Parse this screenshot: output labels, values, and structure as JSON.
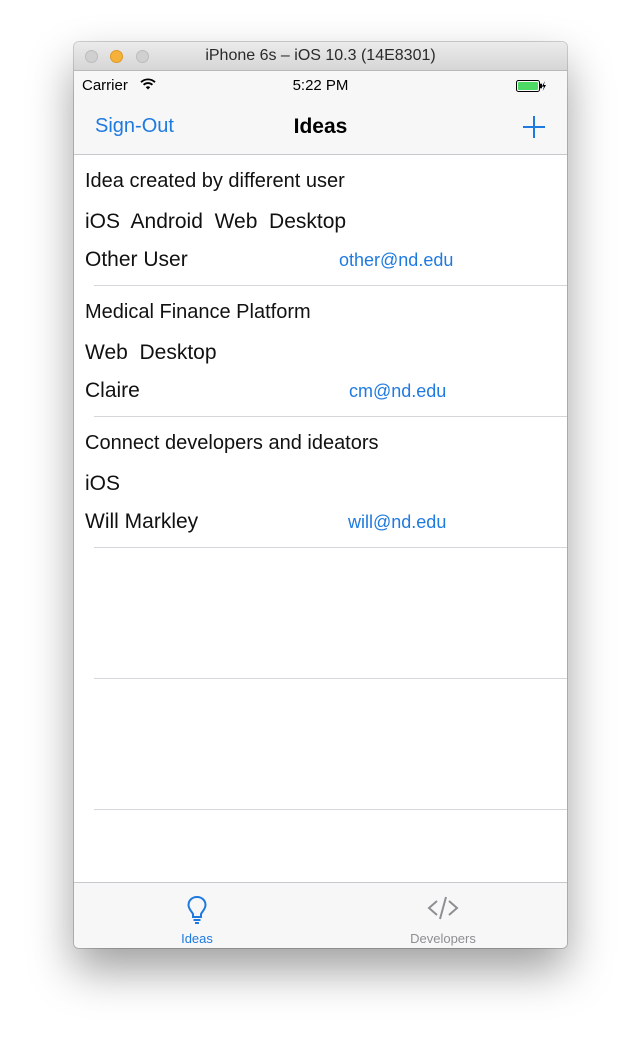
{
  "window": {
    "title": "iPhone 6s – iOS 10.3 (14E8301)"
  },
  "status": {
    "carrier": "Carrier",
    "time": "5:22 PM",
    "wifi_icon": "wifi-icon",
    "battery_icon": "battery-charging-icon",
    "battery_level": 1.0,
    "battery_color": "#4cd964"
  },
  "nav": {
    "left_label": "Sign-Out",
    "title": "Ideas",
    "right_icon": "plus-icon"
  },
  "ideas": [
    {
      "title": "Idea created by different user",
      "platforms": "iOS  Android  Web  Desktop",
      "author": "Other User",
      "email": "other@nd.edu"
    },
    {
      "title": "Medical Finance Platform",
      "platforms": "Web  Desktop",
      "author": "Claire",
      "email": "cm@nd.edu"
    },
    {
      "title": "Connect developers and ideators",
      "platforms": "iOS",
      "author": "Will Markley",
      "email": "will@nd.edu"
    }
  ],
  "tabs": [
    {
      "label": "Ideas",
      "icon": "lightbulb-icon",
      "selected": true
    },
    {
      "label": "Developers",
      "icon": "code-icon",
      "selected": false
    }
  ],
  "colors": {
    "accent": "#1f7ae0",
    "inactive_tab": "#8e8e93"
  }
}
